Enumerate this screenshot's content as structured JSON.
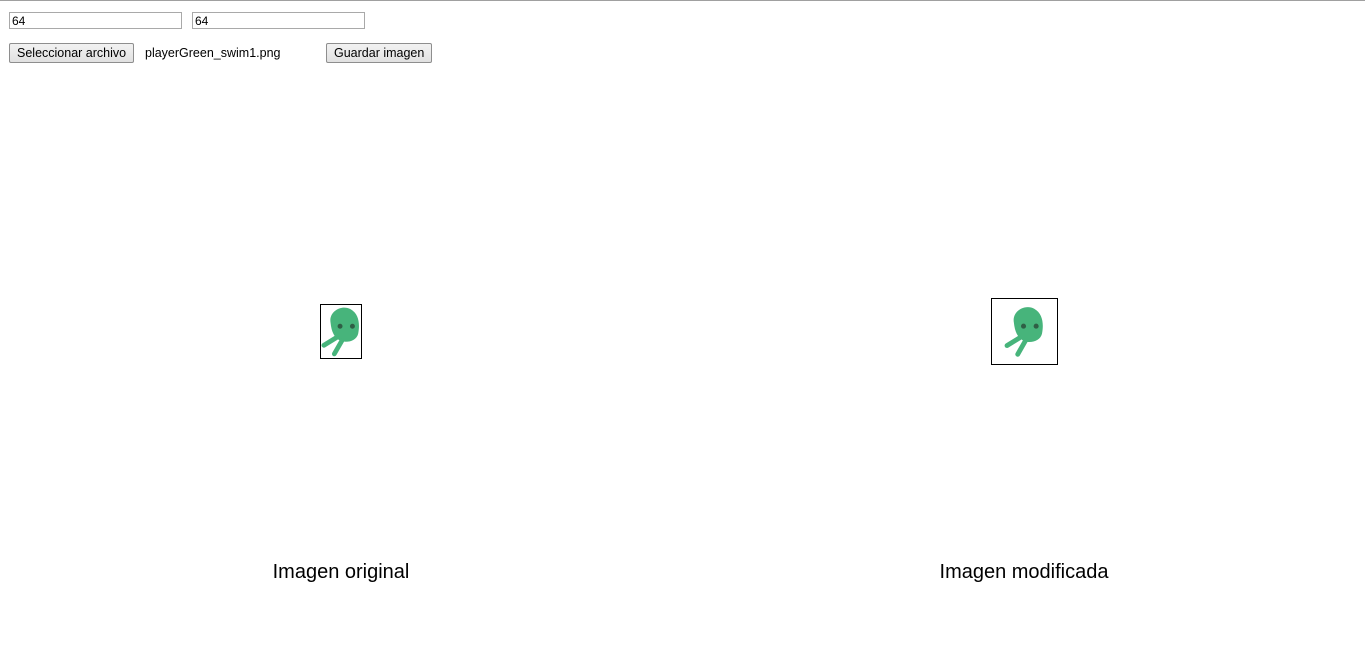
{
  "controls": {
    "width_value": "64",
    "height_value": "64",
    "file_button_label": "Seleccionar archivo",
    "file_name": "playerGreen_swim1.png",
    "save_button_label": "Guardar imagen"
  },
  "panels": {
    "original_caption": "Imagen original",
    "modified_caption": "Imagen modificada"
  },
  "sprite": {
    "icon": "green-swimmer-sprite-icon",
    "body_color": "#47b47b",
    "eye_color": "#2f5e45"
  }
}
